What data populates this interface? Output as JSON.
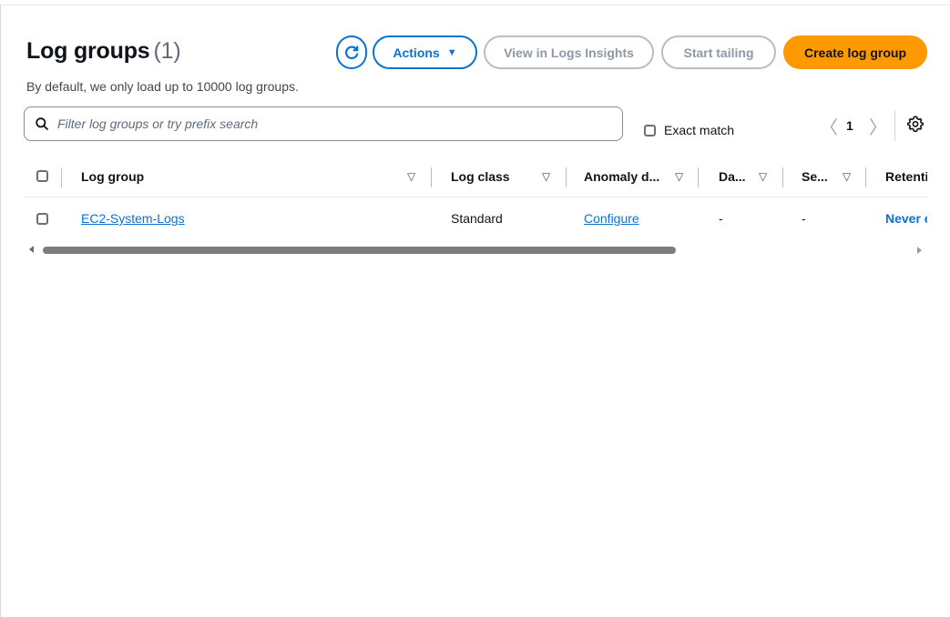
{
  "header": {
    "title": "Log groups",
    "count": "(1)",
    "subtitle": "By default, we only load up to 10000 log groups."
  },
  "toolbar": {
    "refresh_icon": "refresh-icon",
    "actions_label": "Actions",
    "actions_caret": "▼",
    "insights_label": "View in Logs Insights",
    "tailing_label": "Start tailing",
    "create_label": "Create log group"
  },
  "search": {
    "placeholder": "Filter log groups or try prefix search",
    "value": "",
    "exact_match_label": "Exact match",
    "exact_match_checked": false
  },
  "pagination": {
    "prev": "〈",
    "current": "1",
    "next": "〉"
  },
  "table": {
    "columns": [
      "Log group",
      "Log class",
      "Anomaly d...",
      "Da...",
      "Se...",
      "Retenti"
    ],
    "rows": [
      {
        "log_group": "EC2-System-Logs",
        "log_class": "Standard",
        "anomaly": "Configure",
        "data": "-",
        "sensitive": "-",
        "retention": "Never e"
      }
    ]
  },
  "colors": {
    "primary_blue": "#0972d3",
    "accent_orange": "#ff9900",
    "disabled_gray": "#8d99a8"
  }
}
